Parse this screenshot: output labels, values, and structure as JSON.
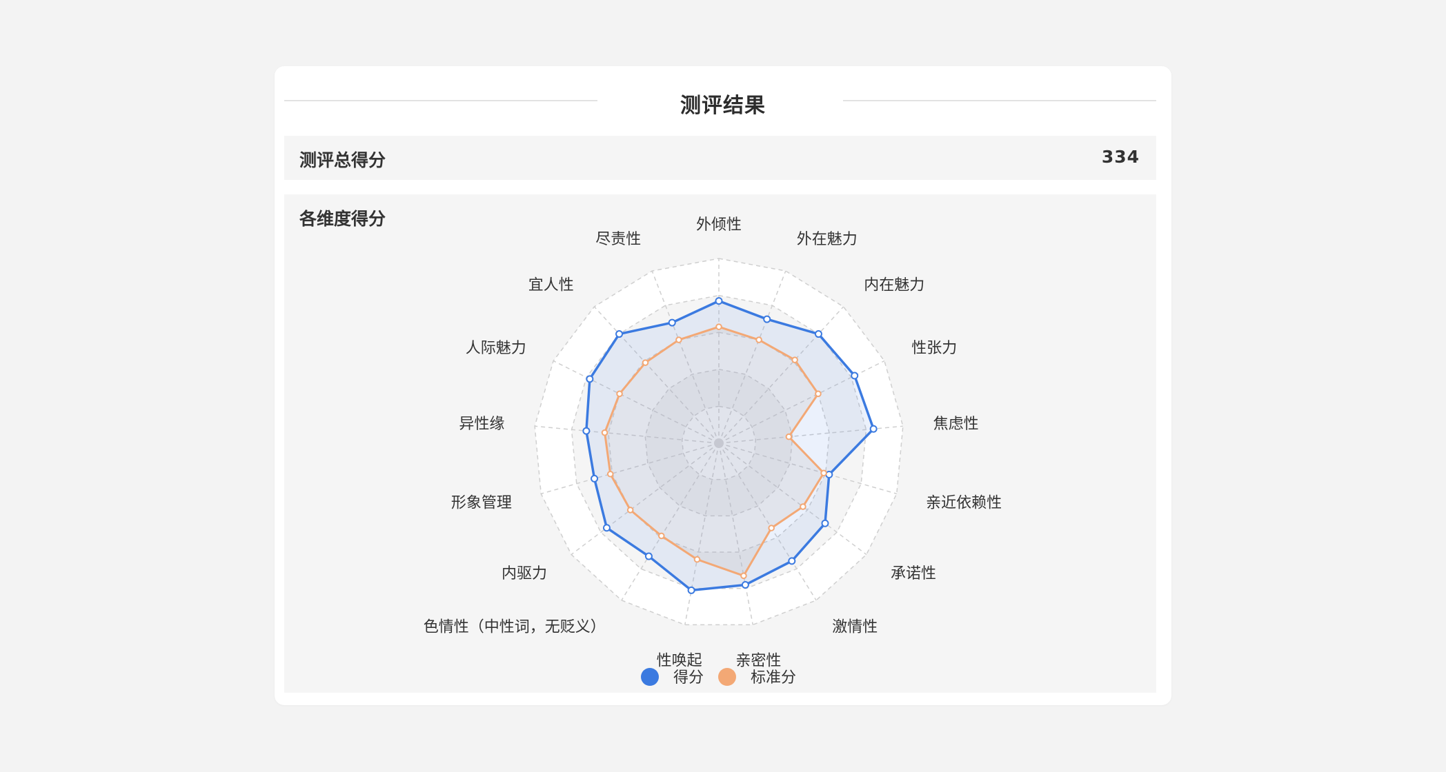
{
  "header": {
    "title": "测评结果"
  },
  "total": {
    "label": "测评总得分",
    "value": "334"
  },
  "dimensions": {
    "label": "各维度得分"
  },
  "colors": {
    "score": "#3b7ae0",
    "standard": "#f3a875",
    "score_fill": "rgba(59,122,224,0.10)",
    "standard_fill": "rgba(190,180,180,0.22)",
    "grid": "#cfcfcf",
    "band": "#ffffff"
  },
  "chart_data": {
    "type": "radar",
    "categories": [
      "外倾性",
      "外在魅力",
      "内在魅力",
      "性张力",
      "焦虑性",
      "亲近依赖性",
      "承诺性",
      "激情性",
      "亲密性",
      "性唤起",
      "色情性（中性词，无贬义）",
      "内驱力",
      "形象管理",
      "异性缘",
      "人际魅力",
      "宜人性",
      "尽责性"
    ],
    "max": 100,
    "levels": 5,
    "series": [
      {
        "name": "得分",
        "values": [
          77,
          72,
          80,
          82,
          84,
          62,
          72,
          75,
          78,
          81,
          72,
          76,
          70,
          72,
          78,
          80,
          70
        ]
      },
      {
        "name": "标准分",
        "values": [
          63,
          60,
          61,
          60,
          38,
          59,
          57,
          54,
          73,
          64,
          59,
          60,
          61,
          62,
          60,
          59,
          60
        ]
      }
    ],
    "legend_position": "bottom-center"
  }
}
